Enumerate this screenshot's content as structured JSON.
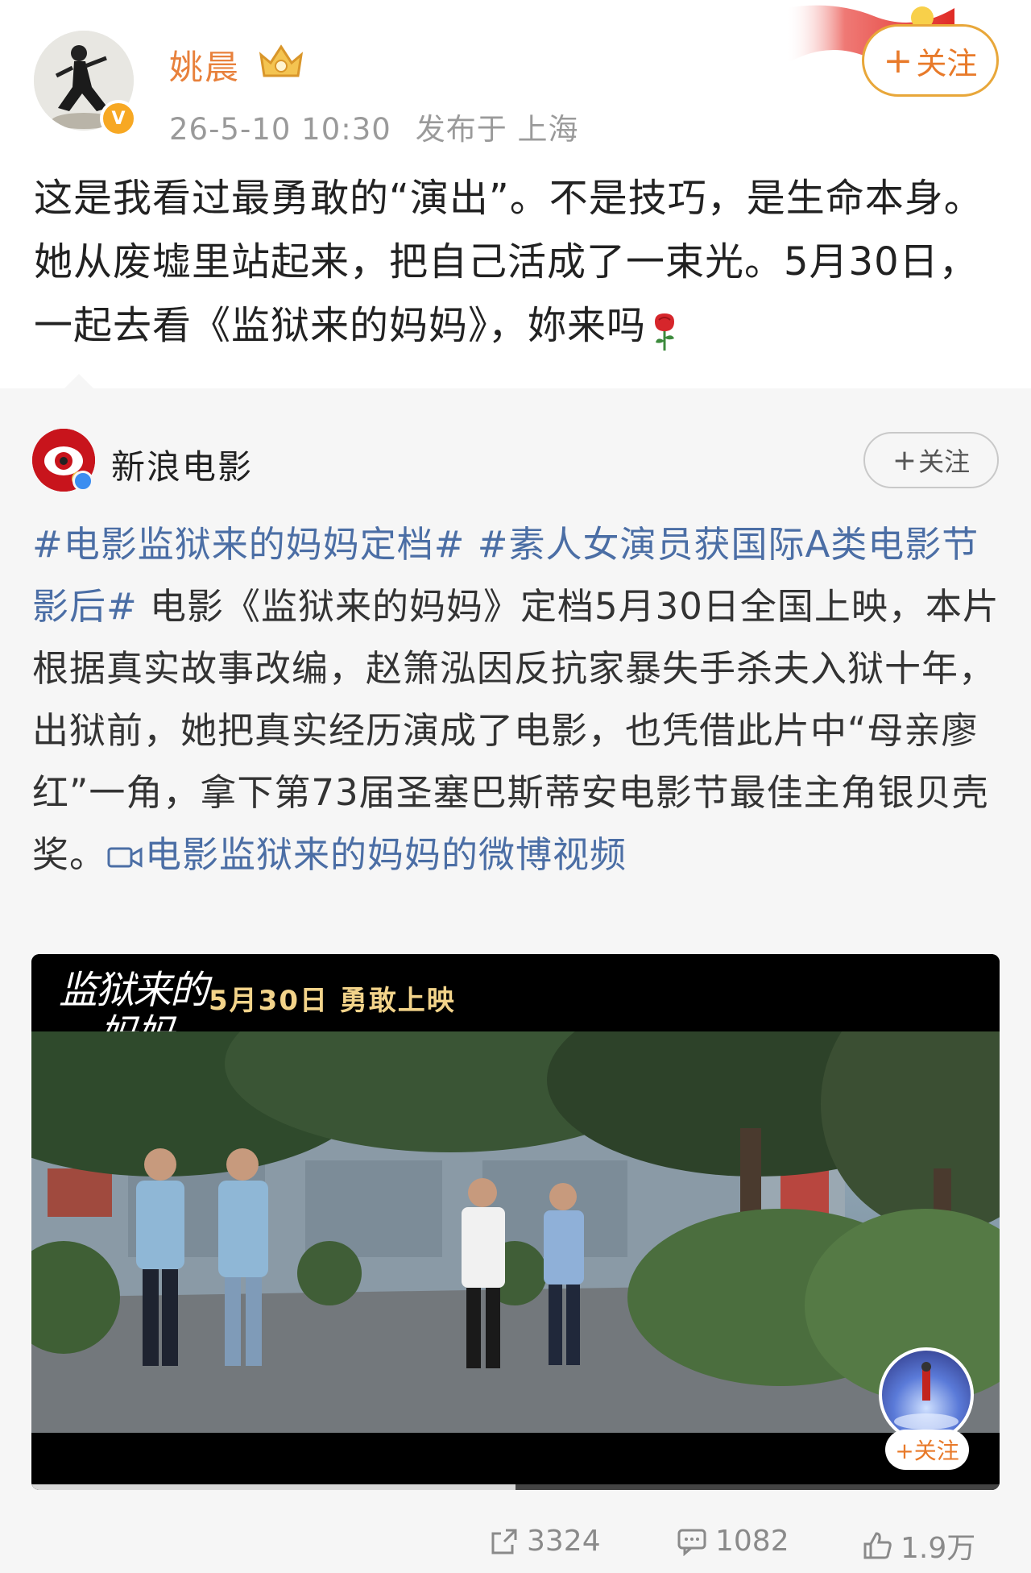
{
  "author": {
    "name": "姚晨",
    "timestamp": "26-5-10 10:30",
    "location": "发布于 上海",
    "follow_label": "关注"
  },
  "post": {
    "text": "这是我看过最勇敢的“演出”。不是技巧，是生命本身。她从废墟里站起来，把自己活成了一束光。5月30日，一起去看《监狱来的妈妈》，妳来吗",
    "emoji": "rose-icon"
  },
  "repost": {
    "name": "新浪电影",
    "follow_label": "关注",
    "topic1": "#电影监狱来的妈妈定档#",
    "topic2": "#素人女演员获国际A类电影节影后#",
    "body": " 电影《监狱来的妈妈》定档5月30日全国上映，本片根据真实故事改编，赵箫泓因反抗家暴失手杀夫入狱十年，出狱前，她把真实经历演成了电影，也凭借此片中“母亲廖红”一角，拿下第73届圣塞巴斯蒂安电影节最佳主角银贝壳奖。",
    "video_link": "电影监狱来的妈妈的微博视频"
  },
  "video": {
    "title_logo_line1": "监狱来的",
    "title_logo_line2": "妈妈",
    "tagline": "5月30日  勇敢上映",
    "mini_follow": "+关注",
    "progress": 0.5
  },
  "actions": {
    "reposts": "3324",
    "comments": "1082",
    "likes": "1.9万"
  },
  "colors": {
    "author_name": "#e8813c",
    "topic_link": "#4b6ea5",
    "follow_border": "#e8a73a"
  }
}
